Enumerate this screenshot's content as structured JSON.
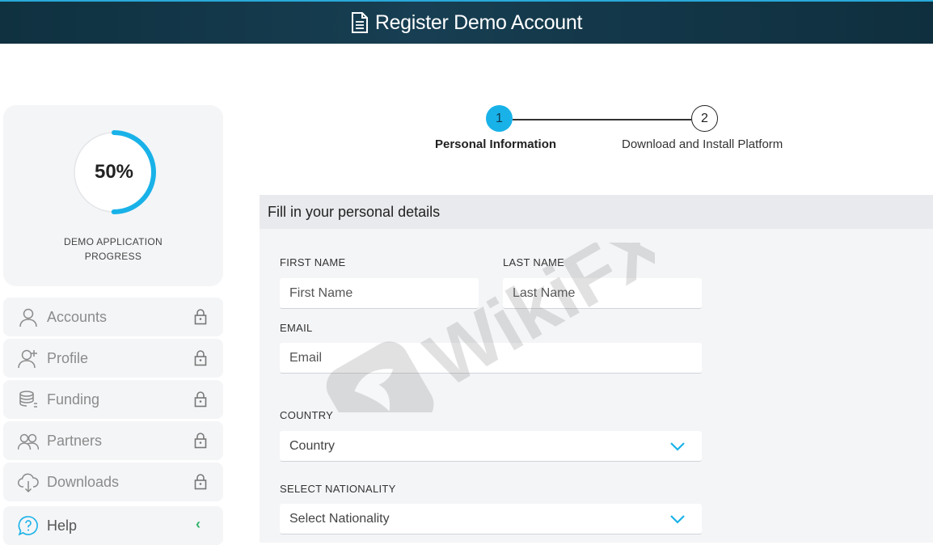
{
  "header": {
    "title": "Register Demo Account",
    "icon": "document-icon"
  },
  "progress": {
    "value_text": "50%",
    "fraction": 0.5,
    "caption_line1": "DEMO APPLICATION",
    "caption_line2": "PROGRESS",
    "accent": "#19b2e8"
  },
  "sidebar": {
    "items": [
      {
        "label": "Accounts",
        "icon": "user-icon",
        "locked": true
      },
      {
        "label": "Profile",
        "icon": "user-plus-icon",
        "locked": true
      },
      {
        "label": "Funding",
        "icon": "coins-icon",
        "locked": true
      },
      {
        "label": "Partners",
        "icon": "users-icon",
        "locked": true
      },
      {
        "label": "Downloads",
        "icon": "cloud-download-icon",
        "locked": true
      },
      {
        "label": "Help",
        "icon": "help-chat-icon",
        "locked": false
      }
    ]
  },
  "stepper": {
    "steps": [
      {
        "number": "1",
        "label": "Personal Information",
        "active": true
      },
      {
        "number": "2",
        "label": "Download and Install Platform",
        "active": false
      }
    ]
  },
  "form": {
    "heading": "Fill in your personal details",
    "first_name": {
      "label": "FIRST NAME",
      "placeholder": "First Name",
      "value": ""
    },
    "last_name": {
      "label": "LAST NAME",
      "placeholder": "Last Name",
      "value": ""
    },
    "email": {
      "label": "EMAIL",
      "placeholder": "Email",
      "value": ""
    },
    "country": {
      "label": "COUNTRY",
      "selected": "Country"
    },
    "nationality": {
      "label": "SELECT NATIONALITY",
      "selected": "Select Nationality"
    }
  },
  "watermark": {
    "text": "WikiFX"
  }
}
